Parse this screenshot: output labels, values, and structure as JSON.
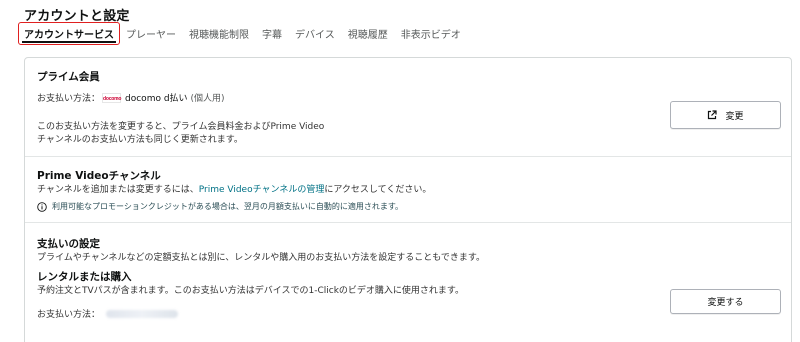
{
  "page": {
    "title": "アカウントと設定"
  },
  "tabs": [
    {
      "label": "アカウントサービス",
      "active": true
    },
    {
      "label": "プレーヤー"
    },
    {
      "label": "視聴機能制限"
    },
    {
      "label": "字幕"
    },
    {
      "label": "デバイス"
    },
    {
      "label": "視聴履歴"
    },
    {
      "label": "非表示ビデオ"
    }
  ],
  "prime": {
    "heading": "プライム会員",
    "pay_label": "お支払い方法：",
    "pay_logo": "docomo",
    "pay_name": "docomo d払い",
    "pay_note": "(個人用)",
    "desc_line1": "このお支払い方法を変更すると、プライム会員料金およびPrime Video",
    "desc_line2": "チャンネルのお支払い方法も同じく更新されます。",
    "button_label": "変更"
  },
  "channels": {
    "heading": "Prime Videoチャンネル",
    "text_before": "チャンネルを追加または変更するには、",
    "link_text": "Prime Videoチャンネルの管理",
    "text_after": "にアクセスしてください。",
    "info_text": "利用可能なプロモーションクレジットがある場合は、翌月の月額支払いに自動的に適用されます。"
  },
  "payment_settings": {
    "heading": "支払いの設定",
    "desc": "プライムやチャンネルなどの定額支払とは別に、レンタルや購入用のお支払い方法を設定することもできます。",
    "rental_heading": "レンタルまたは購入",
    "rental_desc": "予約注文とTVパスが含まれます。このお支払い方法はデバイスでの1-Clickのビデオ購入に使用されます。",
    "pay_label": "お支払い方法：",
    "button_label": "変更する"
  },
  "colors": {
    "accent_link": "#007185",
    "active_tab_outline": "#e02020",
    "border": "#d5d9d9"
  }
}
